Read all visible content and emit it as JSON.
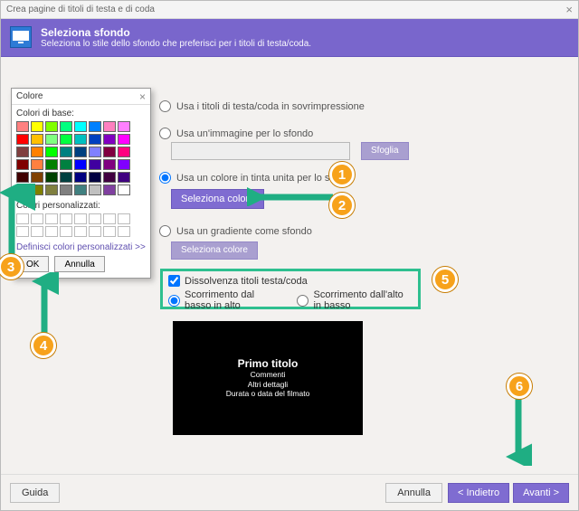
{
  "window": {
    "title": "Crea pagine di titoli di testa e di coda",
    "close_x": "×"
  },
  "header": {
    "title": "Seleziona sfondo",
    "subtitle": "Seleziona lo stile dello sfondo che preferisci per i titoli di testa/coda."
  },
  "options": {
    "overlay": "Usa i titoli di testa/coda in sovrimpressione",
    "image_bg": "Usa un'immagine per lo sfondo",
    "browse": "Sfoglia",
    "solid_color": "Usa un colore in tinta unita per lo sfondo",
    "select_color": "Seleziona colore",
    "gradient": "Usa un gradiente come sfondo",
    "select_color2": "Seleziona colore"
  },
  "motion": {
    "dissolve": "Dissolvenza titoli testa/coda",
    "scroll_bt": "Scorrimento dal basso in alto",
    "scroll_tb": "Scorrimento dall'alto in basso"
  },
  "preview": {
    "title": "Primo titolo",
    "l1": "Commenti",
    "l2": "Altri dettagli",
    "l3": "Durata o data del filmato"
  },
  "footer": {
    "help": "Guida",
    "cancel": "Annulla",
    "back": "< Indietro",
    "next": "Avanti >"
  },
  "colordlg": {
    "title": "Colore",
    "close_x": "×",
    "basic_label": "Colori di base:",
    "custom_label": "Colori personalizzati:",
    "define": "Definisci colori personalizzati >>",
    "ok": "OK",
    "cancel": "Annulla",
    "basic_colors": [
      "#ff8080",
      "#ffff00",
      "#80ff00",
      "#00ff80",
      "#00ffff",
      "#0080ff",
      "#ff80c0",
      "#ff80ff",
      "#ff0000",
      "#ffc000",
      "#80ff80",
      "#00ff40",
      "#00c0c0",
      "#0040c0",
      "#8000c0",
      "#ff00ff",
      "#804040",
      "#ff8000",
      "#00ff00",
      "#008080",
      "#004080",
      "#8080ff",
      "#800040",
      "#ff0080",
      "#800000",
      "#ff8040",
      "#008000",
      "#008040",
      "#0000ff",
      "#4000a0",
      "#800080",
      "#8000ff",
      "#400000",
      "#804000",
      "#004000",
      "#004040",
      "#000080",
      "#000040",
      "#400040",
      "#400080",
      "#000000",
      "#808000",
      "#808040",
      "#808080",
      "#408080",
      "#c0c0c0",
      "#8040a0",
      "#ffffff"
    ]
  },
  "callouts": {
    "1": "1",
    "2": "2",
    "3": "3",
    "4": "4",
    "5": "5",
    "6": "6"
  }
}
